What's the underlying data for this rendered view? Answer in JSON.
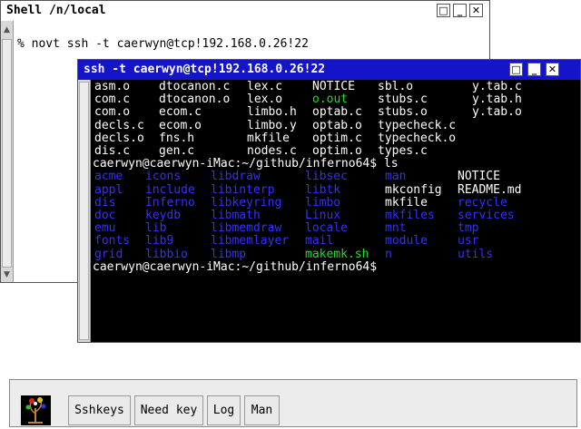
{
  "shell_window": {
    "title": "Shell /n/local",
    "command_line": "% novt ssh -t caerwyn@tcp!192.168.0.26!22"
  },
  "ssh_window": {
    "title": "ssh -t caerwyn@tcp!192.168.0.26!22",
    "listing1": [
      [
        "asm.o",
        "dtocanon.c",
        "lex.c",
        "NOTICE",
        "sbl.o",
        "y.tab.c"
      ],
      [
        "com.c",
        "dtocanon.o",
        "lex.o",
        "o.out",
        "stubs.c",
        "y.tab.h"
      ],
      [
        "com.o",
        "ecom.c",
        "limbo.h",
        "optab.c",
        "stubs.o",
        "y.tab.o"
      ],
      [
        "decls.c",
        "ecom.o",
        "limbo.y",
        "optab.o",
        "typecheck.c"
      ],
      [
        "decls.o",
        "fns.h",
        "mkfile",
        "optim.c",
        "typecheck.o"
      ],
      [
        "dis.c",
        "gen.c",
        "nodes.c",
        "optim.o",
        "types.c"
      ]
    ],
    "prompt_ls": "caerwyn@caerwyn-iMac:~/github/inferno64$ ls",
    "listing2": [
      [
        "acme",
        "icons",
        "libdraw",
        "libsec",
        "man",
        "NOTICE"
      ],
      [
        "appl",
        "include",
        "libinterp",
        "libtk",
        "mkconfig",
        "README.md"
      ],
      [
        "dis",
        "Inferno",
        "libkeyring",
        "limbo",
        "mkfile",
        "recycle"
      ],
      [
        "doc",
        "keydb",
        "libmath",
        "Linux",
        "mkfiles",
        "services"
      ],
      [
        "emu",
        "lib",
        "libmemdraw",
        "locale",
        "mnt",
        "tmp"
      ],
      [
        "fonts",
        "lib9",
        "libmemlayer",
        "mail",
        "module",
        "usr"
      ],
      [
        "grid",
        "libbio",
        "libmp",
        "makemk.sh",
        "n",
        "utils"
      ]
    ],
    "prompt_final": "caerwyn@caerwyn-iMac:~/github/inferno64$"
  },
  "dock": {
    "buttons": [
      "Sshkeys",
      "Need key",
      "Log",
      "Man"
    ]
  },
  "colors": {
    "dir_blue": "#3030ff",
    "exec_green": "#22dd22",
    "term_text": "#ffffff",
    "ssh_title_bg": "#1414c8",
    "shell_title_bg": "#ffffff"
  },
  "icons": {
    "dock_logo": "inferno-tree-logo",
    "window_buttons": [
      "resize-icon",
      "minimize-icon",
      "close-icon"
    ]
  }
}
